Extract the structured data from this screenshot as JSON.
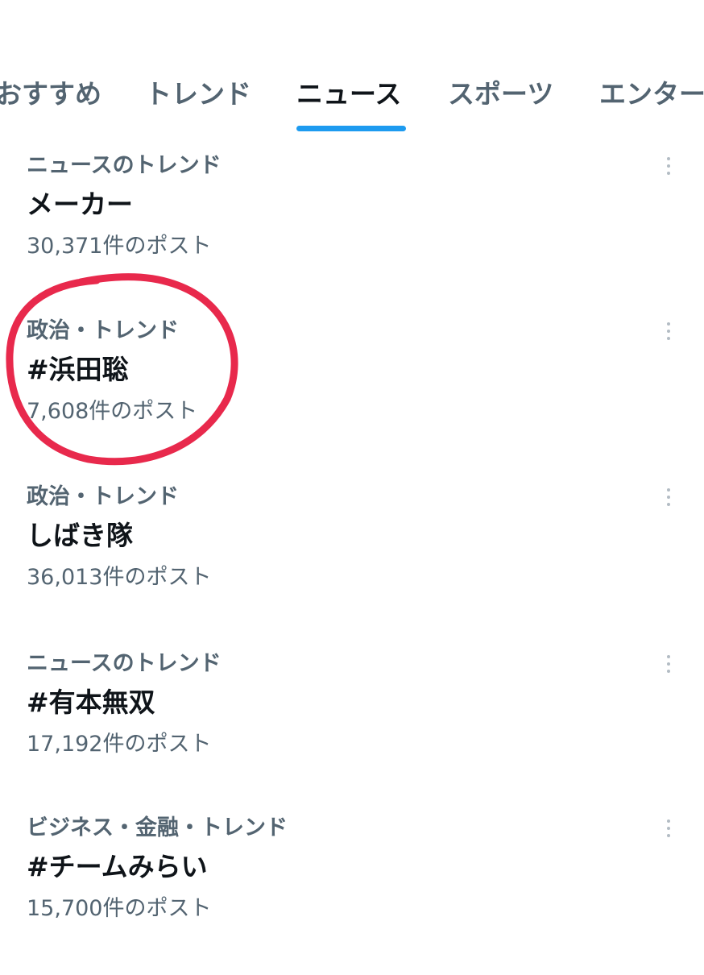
{
  "tabs": [
    {
      "label": "おすすめ",
      "active": false
    },
    {
      "label": "トレンド",
      "active": false
    },
    {
      "label": "ニュース",
      "active": true
    },
    {
      "label": "スポーツ",
      "active": false
    },
    {
      "label": "エンター",
      "active": false
    }
  ],
  "trends": [
    {
      "category": "ニュースのトレンド",
      "title": "メーカー",
      "count": "30,371件のポスト"
    },
    {
      "category": "政治・トレンド",
      "title": "#浜田聡",
      "count": "7,608件のポスト"
    },
    {
      "category": "政治・トレンド",
      "title": "しばき隊",
      "count": "36,013件のポスト"
    },
    {
      "category": "ニュースのトレンド",
      "title": "#有本無双",
      "count": "17,192件のポスト"
    },
    {
      "category": "ビジネス・金融・トレンド",
      "title": "#チームみらい",
      "count": "15,700件のポスト"
    }
  ],
  "icons": {
    "more": "more-vertical-icon"
  },
  "colors": {
    "accent": "#1d9bf0",
    "text_primary": "#0f1419",
    "text_secondary": "#536471",
    "annotation": "#e8294c"
  },
  "annotation": {
    "circled_trend": 1
  }
}
